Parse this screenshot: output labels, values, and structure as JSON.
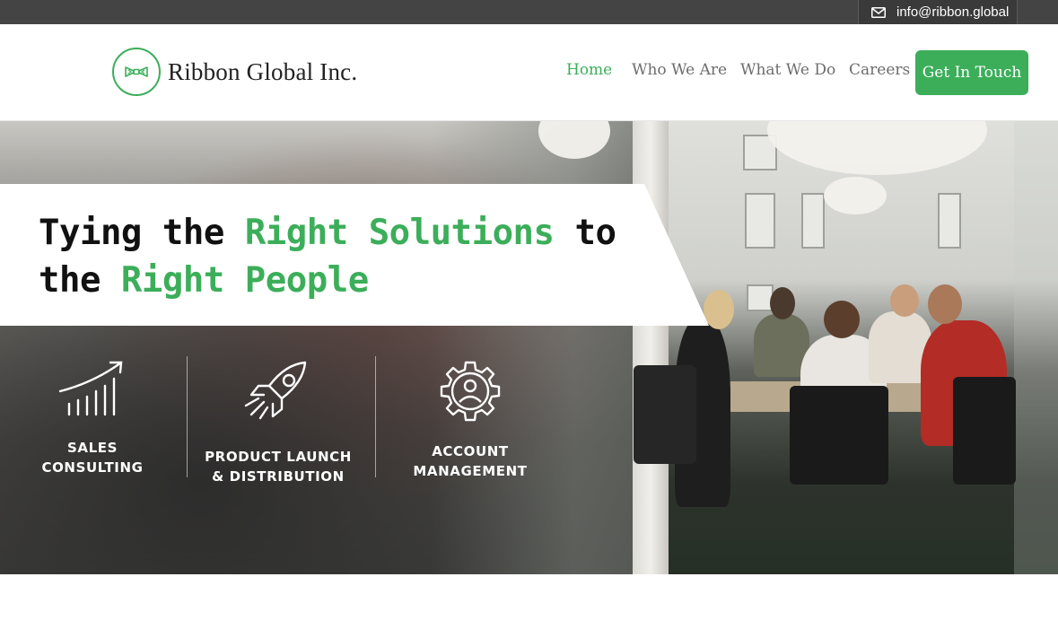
{
  "topbar": {
    "email": "info@ribbon.global",
    "email_icon": "envelope-icon"
  },
  "header": {
    "logo_icon": "bowtie-logo-icon",
    "logo_text": "Ribbon Global Inc.",
    "nav": [
      {
        "label": "Home",
        "active": true
      },
      {
        "label": "Who We Are",
        "active": false
      },
      {
        "label": "What We Do",
        "active": false
      },
      {
        "label": "Careers",
        "active": false
      }
    ],
    "cta_label": "Get In Touch"
  },
  "hero": {
    "headline_part1": "Tying the ",
    "headline_part2": "Right Solutions",
    "headline_part3": " to",
    "headline_part4": "the ",
    "headline_part5": "Right People",
    "services": [
      {
        "icon": "growth-chart-icon",
        "line1": "SALES",
        "line2": "CONSULTING"
      },
      {
        "icon": "rocket-icon",
        "line1": "PRODUCT LAUNCH",
        "line2": "& DISTRIBUTION"
      },
      {
        "icon": "gear-person-icon",
        "line1": "ACCOUNT",
        "line2": "MANAGEMENT"
      }
    ]
  },
  "colors": {
    "accent": "#3cae5a",
    "topbar": "#444444",
    "nav_text": "#6d6d6d",
    "headline_text": "#111111"
  }
}
